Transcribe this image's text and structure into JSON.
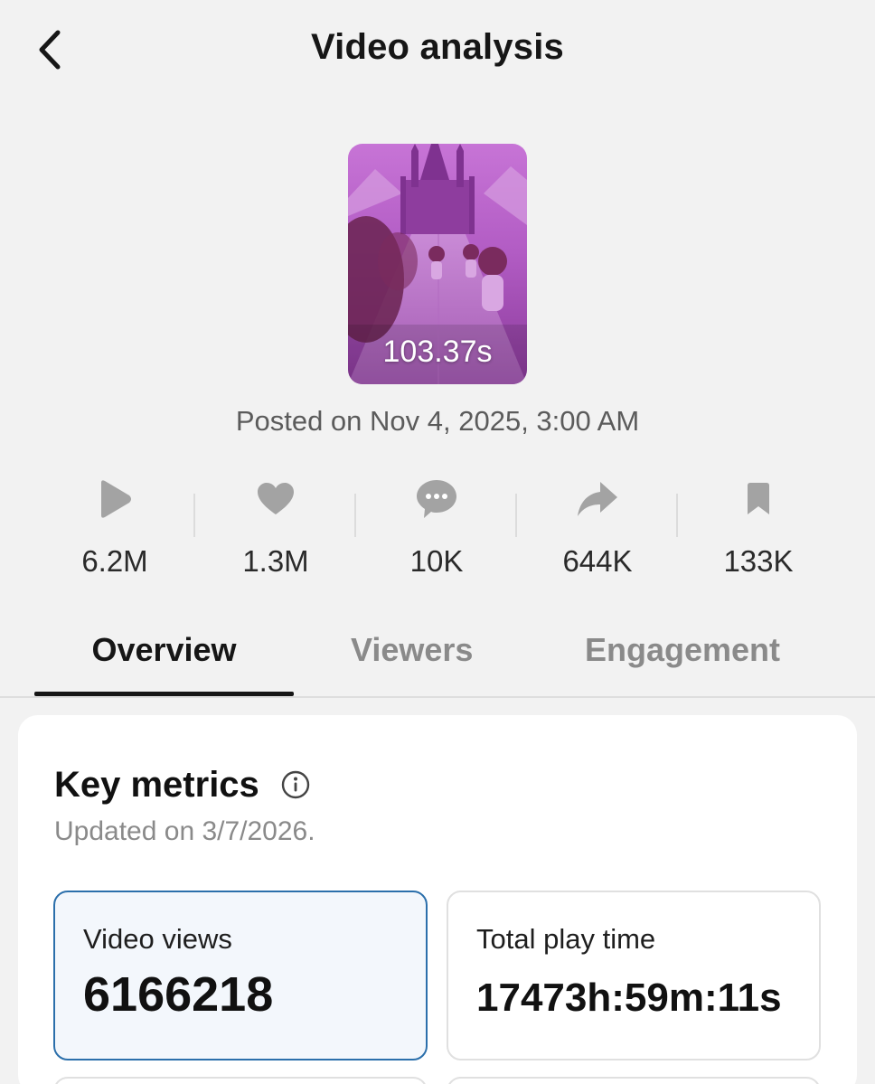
{
  "header": {
    "back_icon": "chevron-left-icon",
    "title": "Video analysis"
  },
  "video": {
    "duration": "103.37s",
    "posted": "Posted on Nov 4, 2025, 3:00 AM",
    "thumbnail_colors": [
      "#9b3fa8",
      "#c56fd1",
      "#6e2a7d"
    ]
  },
  "stats": [
    {
      "icon": "play-icon",
      "value": "6.2M"
    },
    {
      "icon": "heart-icon",
      "value": "1.3M"
    },
    {
      "icon": "comment-icon",
      "value": "10K"
    },
    {
      "icon": "share-icon",
      "value": "644K"
    },
    {
      "icon": "bookmark-icon",
      "value": "133K"
    }
  ],
  "tabs": [
    {
      "label": "Overview",
      "active": true
    },
    {
      "label": "Viewers",
      "active": false
    },
    {
      "label": "Engagement",
      "active": false
    }
  ],
  "key_metrics": {
    "title": "Key metrics",
    "info_icon": "info-icon",
    "updated": "Updated on 3/7/2026.",
    "metrics": [
      {
        "label": "Video views",
        "value": "6166218",
        "selected": true
      },
      {
        "label": "Total play time",
        "value": "17473h:59m:11s",
        "selected": false
      }
    ]
  },
  "colors": {
    "background": "#f2f2f2",
    "icon_gray": "#a3a3a3",
    "selected_border": "#2b6fab",
    "selected_fill": "#f3f7fc"
  }
}
